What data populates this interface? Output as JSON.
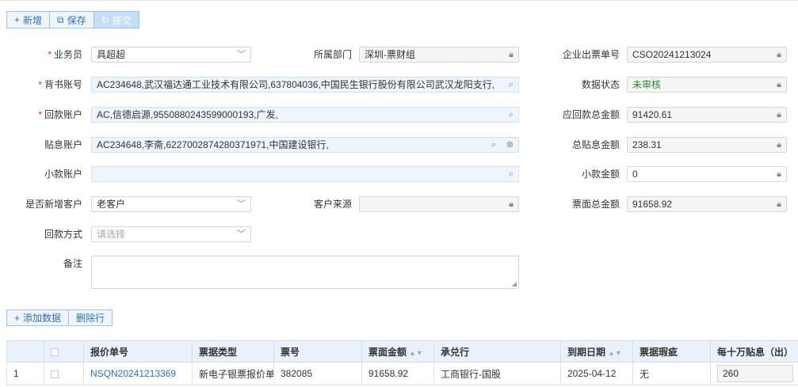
{
  "toolbar": {
    "add": {
      "icon": "plus-icon",
      "glyph": "+",
      "label": "新增"
    },
    "save": {
      "icon": "edit-icon",
      "glyph": "⧉",
      "label": "保存"
    },
    "submit": {
      "icon": "refresh-icon",
      "glyph": "↻",
      "label": "提交"
    }
  },
  "form": {
    "salesman": {
      "label": "业务员",
      "value": "具超超"
    },
    "department": {
      "label": "所属部门",
      "value": "深圳-票财组"
    },
    "order_no": {
      "label": "企业出票单号",
      "value": "CSO20241213024"
    },
    "endorse_account": {
      "label": "背书账号",
      "value": "AC234648,武汉福达通工业技术有限公司,637804036,中国民生银行股份有限公司武汉龙阳支行,"
    },
    "data_status": {
      "label": "数据状态",
      "value": "未审核"
    },
    "return_account": {
      "label": "回款账户",
      "value": "AC,信德启源,9550880243599000193,广发,"
    },
    "receivable_total": {
      "label": "应回款总金额",
      "value": "91420.61"
    },
    "discount_account": {
      "label": "贴息账户",
      "value": "AC234648,李斋,6227002874280371971,中国建设银行,"
    },
    "discount_total": {
      "label": "总贴息金额",
      "value": "238.31"
    },
    "small_account": {
      "label": "小款账户",
      "value": ""
    },
    "small_amount": {
      "label": "小款金额",
      "value": "0"
    },
    "new_customer": {
      "label": "是否新增客户",
      "value": "老客户"
    },
    "customer_source": {
      "label": "客户来源",
      "value": ""
    },
    "face_total": {
      "label": "票面总金额",
      "value": "91658.92"
    },
    "payment_method": {
      "label": "回款方式",
      "placeholder": "请选择"
    },
    "remark": {
      "label": "备注",
      "value": ""
    }
  },
  "table_toolbar": {
    "add_data": {
      "icon": "plus-icon",
      "glyph": "+",
      "label": "添加数据"
    },
    "delete_row": {
      "label": "删除行"
    }
  },
  "table": {
    "headers": [
      "报价单号",
      "票据类型",
      "票号",
      "票面金额",
      "承兑行",
      "到期日期",
      "票据瑕疵",
      "每十万贴息（出）"
    ],
    "rows": [
      {
        "index": "1",
        "quote_no": "NSQN20241213369",
        "bill_type": "新电子银票报价单",
        "bill_no": "382085",
        "face_amount": "91658.92",
        "acceptor": "工商银行-国股",
        "due_date": "2025-04-12",
        "defect": "无",
        "discount_per_100k": "260"
      }
    ]
  }
}
